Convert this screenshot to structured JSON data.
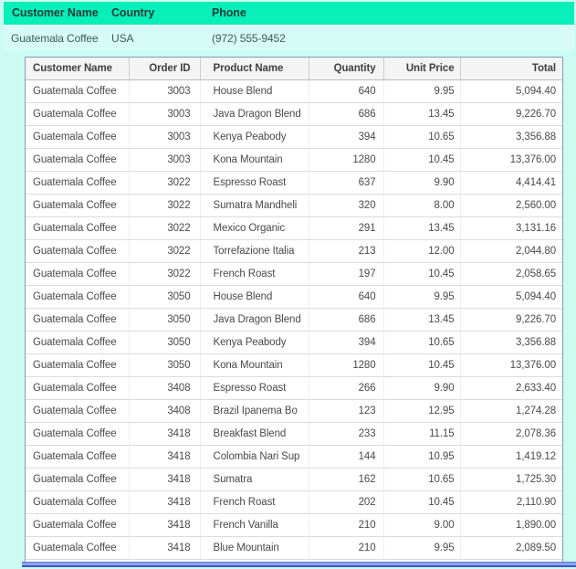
{
  "summary_table": {
    "headers": {
      "customer_name": "Customer Name",
      "country": "Country",
      "phone": "Phone"
    },
    "row": {
      "customer_name": "Guatemala Coffee",
      "country": "USA",
      "phone": "(972) 555-9452"
    }
  },
  "detail_table": {
    "columns": [
      "Customer Name",
      "Order ID",
      "Product Name",
      "Quantity",
      "Unit Price",
      "Total"
    ],
    "rows": [
      [
        "Guatemala Coffee",
        "3003",
        "House Blend",
        "640",
        "9.95",
        "5,094.40"
      ],
      [
        "Guatemala Coffee",
        "3003",
        "Java Dragon Blend",
        "686",
        "13.45",
        "9,226.70"
      ],
      [
        "Guatemala Coffee",
        "3003",
        "Kenya Peabody",
        "394",
        "10.65",
        "3,356.88"
      ],
      [
        "Guatemala Coffee",
        "3003",
        "Kona Mountain",
        "1280",
        "10.45",
        "13,376.00"
      ],
      [
        "Guatemala Coffee",
        "3022",
        "Espresso Roast",
        "637",
        "9.90",
        "4,414.41"
      ],
      [
        "Guatemala Coffee",
        "3022",
        "Sumatra Mandheli",
        "320",
        "8.00",
        "2,560.00"
      ],
      [
        "Guatemala Coffee",
        "3022",
        "Mexico Organic",
        "291",
        "13.45",
        "3,131.16"
      ],
      [
        "Guatemala Coffee",
        "3022",
        "Torrefazione Italia",
        "213",
        "12.00",
        "2,044.80"
      ],
      [
        "Guatemala Coffee",
        "3022",
        "French Roast",
        "197",
        "10.45",
        "2,058.65"
      ],
      [
        "Guatemala Coffee",
        "3050",
        "House Blend",
        "640",
        "9.95",
        "5,094.40"
      ],
      [
        "Guatemala Coffee",
        "3050",
        "Java Dragon Blend",
        "686",
        "13.45",
        "9,226.70"
      ],
      [
        "Guatemala Coffee",
        "3050",
        "Kenya Peabody",
        "394",
        "10.65",
        "3,356.88"
      ],
      [
        "Guatemala Coffee",
        "3050",
        "Kona Mountain",
        "1280",
        "10.45",
        "13,376.00"
      ],
      [
        "Guatemala Coffee",
        "3408",
        "Espresso Roast",
        "266",
        "9.90",
        "2,633.40"
      ],
      [
        "Guatemala Coffee",
        "3408",
        "Brazil Ipanema Bo",
        "123",
        "12.95",
        "1,274.28"
      ],
      [
        "Guatemala Coffee",
        "3418",
        "Breakfast Blend",
        "233",
        "11.15",
        "2,078.36"
      ],
      [
        "Guatemala Coffee",
        "3418",
        "Colombia Nari Sup",
        "144",
        "10.95",
        "1,419.12"
      ],
      [
        "Guatemala Coffee",
        "3418",
        "Sumatra",
        "162",
        "10.65",
        "1,725.30"
      ],
      [
        "Guatemala Coffee",
        "3418",
        "French Roast",
        "202",
        "10.45",
        "2,110.90"
      ],
      [
        "Guatemala Coffee",
        "3418",
        "French Vanilla",
        "210",
        "9.00",
        "1,890.00"
      ],
      [
        "Guatemala Coffee",
        "3418",
        "Blue Mountain",
        "210",
        "9.95",
        "2,089.50"
      ]
    ]
  },
  "colors": {
    "header_green": "#08efba",
    "page_bg": "#ccfbf2",
    "summary_row_bg": "#d6fcf5",
    "table_border": "#8598bd",
    "table_header_bg": "#f4f4f4",
    "scrollbar_blue": "#8da4ea",
    "scrollbar_border_blue": "#3d57c0"
  }
}
